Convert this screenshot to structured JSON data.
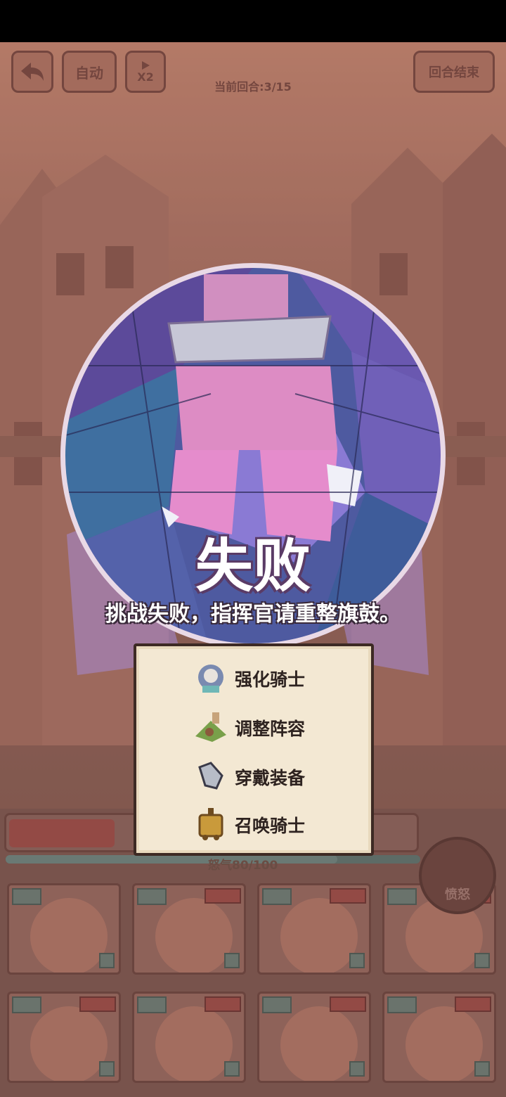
{
  "toolbar": {
    "back_label": "",
    "auto_label": "自动",
    "speed_label": "X2",
    "end_turn_label": "回合结束",
    "round_text": "当前回合:3/15"
  },
  "result": {
    "title": "失败",
    "subtitle": "挑战失败，指挥官请重整旗鼓。"
  },
  "tips": [
    {
      "icon": "knight-portrait-icon",
      "label": "强化骑士"
    },
    {
      "icon": "plant-creature-icon",
      "label": "调整阵容"
    },
    {
      "icon": "armor-gauntlet-icon",
      "label": "穿戴装备"
    },
    {
      "icon": "golden-locomotive-icon",
      "label": "召唤骑士"
    }
  ],
  "rage": {
    "label": "怒气80/100",
    "value": 80,
    "max": 100,
    "button_label": "愤怒"
  },
  "colors": {
    "background": "#9a6b5c",
    "panel": "#f3e8d3",
    "accent_bar": "#a0524a"
  }
}
